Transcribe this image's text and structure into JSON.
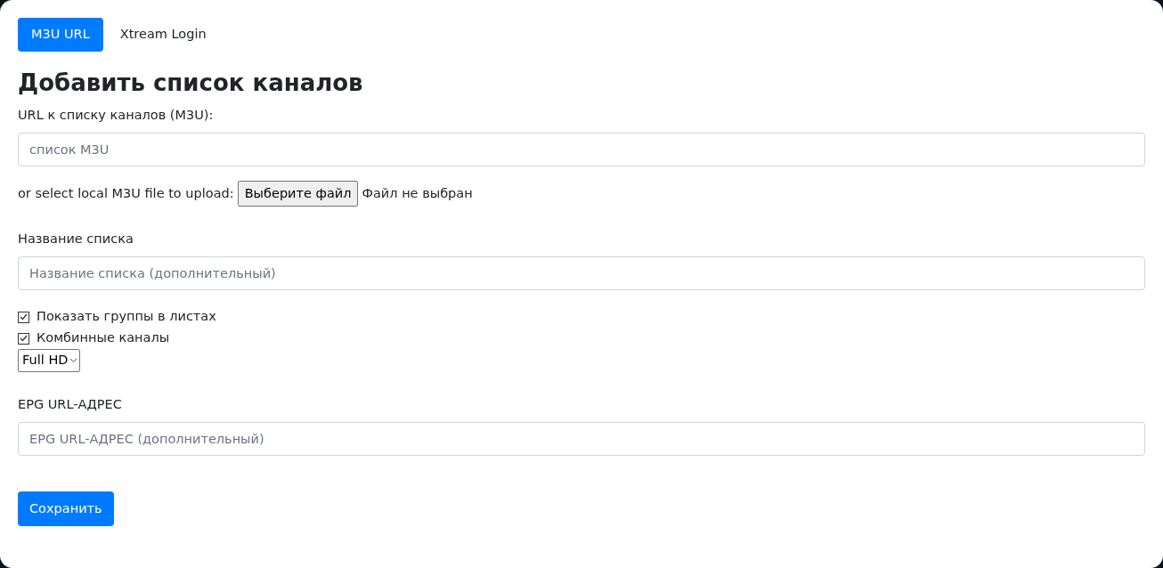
{
  "tabs": [
    {
      "label": "M3U URL",
      "selected": true
    },
    {
      "label": "Xtream Login",
      "selected": false
    }
  ],
  "heading": "Добавить список каналов",
  "url_field": {
    "label": "URL к списку каналов (M3U):",
    "placeholder": "список M3U"
  },
  "file_upload": {
    "label": "or select local M3U file to upload:",
    "button": "Выберите файл",
    "status": "Файл не выбран"
  },
  "name_field": {
    "label": "Название списка",
    "placeholder": "Название списка (дополнительный)"
  },
  "checkboxes": [
    {
      "label": "Показать группы в листах",
      "checked": true
    },
    {
      "label": "Комбинные каналы",
      "checked": true
    }
  ],
  "quality_select": {
    "value": "Full HD"
  },
  "epg_field": {
    "label": "EPG URL-АДРЕС",
    "placeholder": "EPG URL-АДРЕС (дополнительный)"
  },
  "save_button": "Сохранить"
}
